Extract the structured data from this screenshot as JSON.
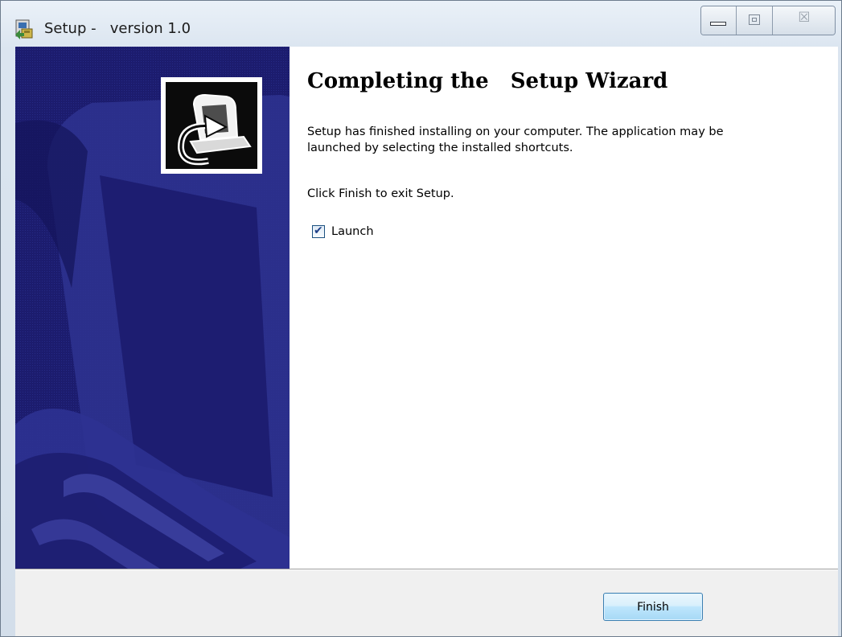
{
  "window": {
    "title": "Setup -   version 1.0",
    "icons": {
      "app": "setup-installer-icon",
      "minimize": "minimize-icon",
      "maximize": "maximize-icon",
      "close": "close-icon"
    },
    "close_glyph": "☒"
  },
  "side_panel": {
    "image": "wizard-banner-image",
    "logo_icon": "computer-install-icon"
  },
  "main": {
    "heading": "Completing the   Setup Wizard",
    "finished_text": "Setup has finished installing   on your computer. The application may be\nlaunched by selecting the installed shortcuts.",
    "exit_text": "Click Finish to exit Setup.",
    "launch_checkbox": {
      "label": "Launch",
      "checked": true,
      "mark": "✔"
    }
  },
  "footer": {
    "finish_label": "Finish"
  },
  "colors": {
    "banner_navy": "#1c1c6e",
    "banner_accent": "#2e3291",
    "button_border": "#3c7fb1",
    "content_bg": "#ffffff"
  }
}
